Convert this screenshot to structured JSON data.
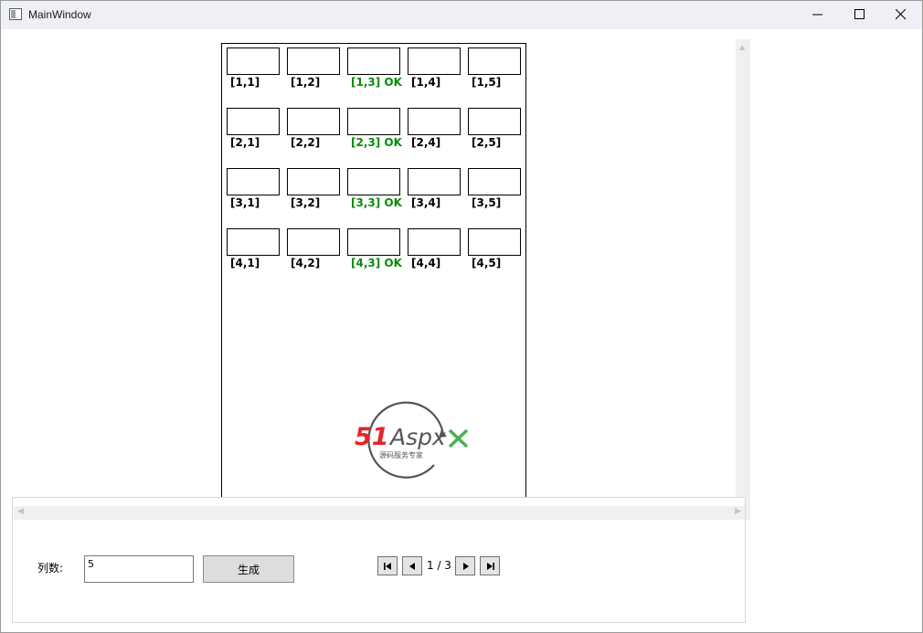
{
  "window": {
    "title": "MainWindow"
  },
  "grid": {
    "rows": [
      [
        "[1,1]",
        "[1,2]",
        "[1,3] OK",
        "[1,4]",
        "[1,5]"
      ],
      [
        "[2,1]",
        "[2,2]",
        "[2,3] OK",
        "[2,4]",
        "[2,5]"
      ],
      [
        "[3,1]",
        "[3,2]",
        "[3,3] OK",
        "[3,4]",
        "[3,5]"
      ],
      [
        "[4,1]",
        "[4,2]",
        "[4,3] OK",
        "[4,4]",
        "[4,5]"
      ]
    ],
    "ok_column": 3,
    "ok_color": "#0a8a0a"
  },
  "logo": {
    "brand_red": "51",
    "brand_dark": "Aspx",
    "tagline": "源码服务专家",
    "colors": {
      "red": "#e8232a",
      "dark": "#555555",
      "green": "#4caf50"
    }
  },
  "controls": {
    "columns_label": "列数:",
    "columns_value": "5",
    "generate_label": "生成",
    "pager_text": "1 / 3"
  },
  "icons": {
    "first": "first-page-icon",
    "prev": "prev-page-icon",
    "next": "next-page-icon",
    "last": "last-page-icon"
  }
}
